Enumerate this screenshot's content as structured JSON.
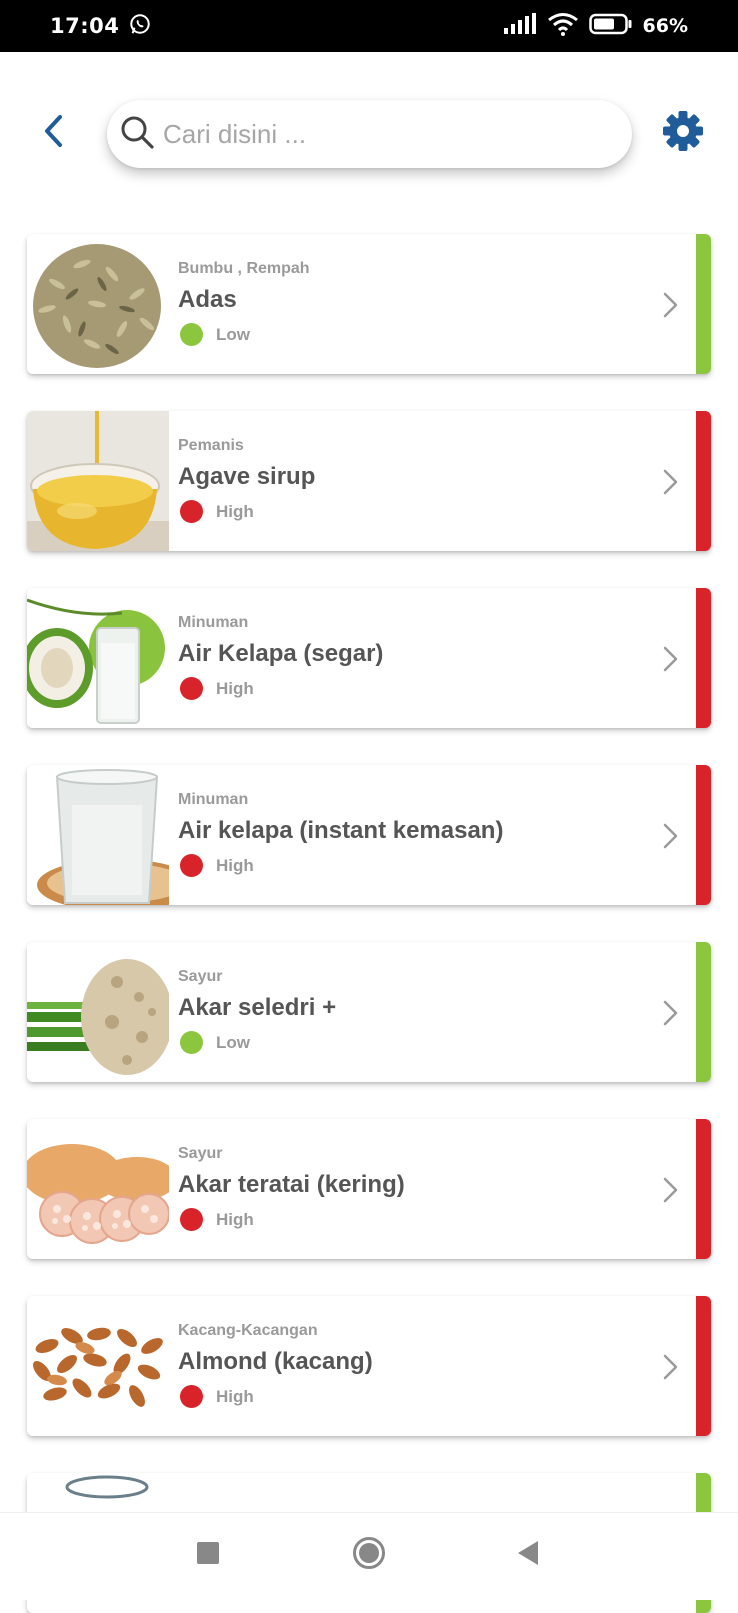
{
  "status_bar": {
    "time": "17:04",
    "battery_percent": "66%",
    "icons": [
      "whatsapp-icon",
      "signal-icon",
      "wifi-icon",
      "battery-icon"
    ]
  },
  "header": {
    "search_placeholder": "Cari disini ...",
    "icons": [
      "back-arrow-icon",
      "search-icon",
      "gear-icon"
    ],
    "accent_color": "#1f5c99"
  },
  "level_colors": {
    "Low": "#8cc63f",
    "High": "#d9232a"
  },
  "items": [
    {
      "category": "Bumbu , Rempah",
      "name": "Adas",
      "level": "Low",
      "image": "fennel-seeds-image"
    },
    {
      "category": "Pemanis",
      "name": "Agave sirup",
      "level": "High",
      "image": "syrup-bowl-image"
    },
    {
      "category": "Minuman",
      "name": "Air Kelapa (segar)",
      "level": "High",
      "image": "fresh-coconut-image"
    },
    {
      "category": "Minuman",
      "name": "Air kelapa (instant kemasan)",
      "level": "High",
      "image": "coconut-water-glass-image"
    },
    {
      "category": "Sayur",
      "name": "Akar seledri +",
      "level": "Low",
      "image": "celery-root-image"
    },
    {
      "category": "Sayur",
      "name": "Akar teratai (kering)",
      "level": "High",
      "image": "lotus-root-image"
    },
    {
      "category": "Kacang-Kacangan",
      "name": "Almond (kacang)",
      "level": "High",
      "image": "almonds-image"
    }
  ],
  "nav_bar": {
    "icons": [
      "recent-apps-icon",
      "home-icon",
      "back-icon"
    ]
  }
}
